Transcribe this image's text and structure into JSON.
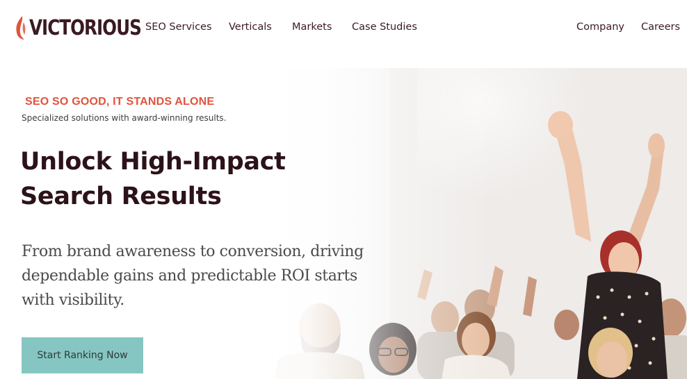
{
  "brand": {
    "name": "VICTORIOUS",
    "accent": "#e0533c",
    "dark": "#3a1a22"
  },
  "nav": {
    "links": [
      "SEO Services",
      "Verticals",
      "Markets",
      "Case Studies"
    ],
    "right_links": [
      "Company",
      "Careers"
    ]
  },
  "hero": {
    "eyebrow": "SEO SO GOOD, IT STANDS ALONE",
    "subline": "Specialized solutions with award-winning results.",
    "headline": "Unlock High-Impact Search Results",
    "body": "From brand awareness to conversion, driving dependable gains and predictable ROI starts with visibility.",
    "cta_label": "Start Ranking Now",
    "cta_color": "#86c6c2",
    "image": "photo of cheering crowd with raised arms"
  }
}
